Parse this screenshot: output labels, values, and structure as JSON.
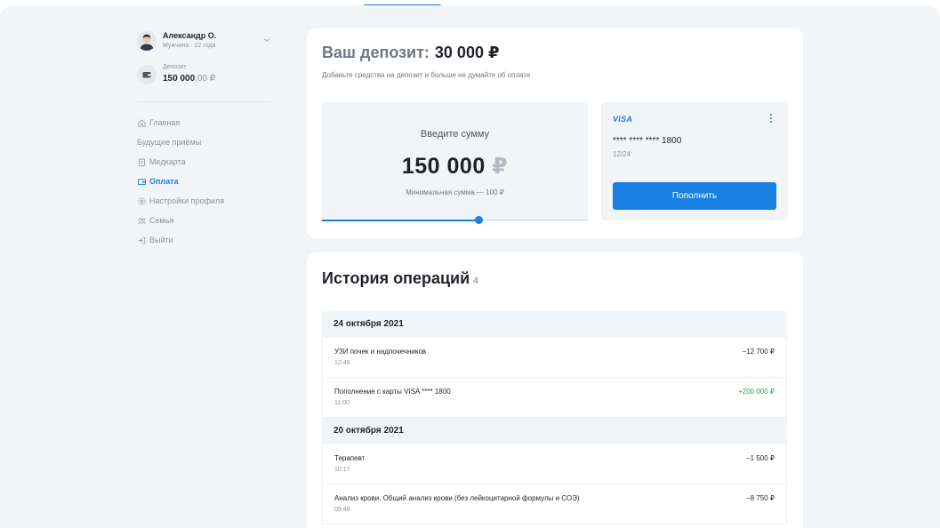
{
  "user": {
    "name": "Александр О.",
    "sub": "Мужчина  ·  22 года"
  },
  "deposit_widget": {
    "label": "Депозит",
    "amount_int": "150 000",
    "amount_dec": ",00 ₽"
  },
  "menu": [
    {
      "label": "Главная",
      "icon": "home-icon",
      "active": false
    },
    {
      "label": "Будущие приёмы",
      "icon": "",
      "active": false
    },
    {
      "label": "Медкарта",
      "icon": "clipboard-icon",
      "active": false
    },
    {
      "label": "Оплата",
      "icon": "wallet-icon",
      "active": true
    },
    {
      "label": "Настройки профиля",
      "icon": "gear-icon",
      "active": false
    },
    {
      "label": "Семья",
      "icon": "people-icon",
      "active": false
    },
    {
      "label": "Выйти",
      "icon": "logout-icon",
      "active": false
    }
  ],
  "deposit": {
    "title_prefix": "Ваш депозит:",
    "title_value": "30 000 ₽",
    "description": "Добавьте средства на депозит и больше не думайте об оплате",
    "enter_label": "Введите сумму",
    "amount_value": "150 000",
    "amount_currency": "₽",
    "min_hint": "Минимальная сумма — 100 ₽",
    "slider_fraction": 0.59
  },
  "card": {
    "brand": "VISA",
    "number": "**** **** **** 1800",
    "expiry": "12/24",
    "topup_label": "Пополнить"
  },
  "history": {
    "title": "История операций",
    "count": "4",
    "groups": [
      {
        "date": "24 октября 2021",
        "ops": [
          {
            "title": "УЗИ почек и надпочечников",
            "time": "12:49",
            "amount": "−12 700 ₽",
            "positive": false
          },
          {
            "title": "Пополнение с карты VISA **** 1800",
            "time": "11:00",
            "amount": "+200 000 ₽",
            "positive": true
          }
        ]
      },
      {
        "date": "20 октября 2021",
        "ops": [
          {
            "title": "Терапевт",
            "time": "10:17",
            "amount": "−1 500 ₽",
            "positive": false
          },
          {
            "title": "Анализ крови. Общий анализ крови (без лейкоцитарной формулы и СОЭ)",
            "time": "09:48",
            "amount": "−8 750 ₽",
            "positive": false
          }
        ]
      }
    ]
  },
  "colors": {
    "accent": "#1a7fe3",
    "positive": "#22a45d",
    "background": "#f2f5f7"
  }
}
